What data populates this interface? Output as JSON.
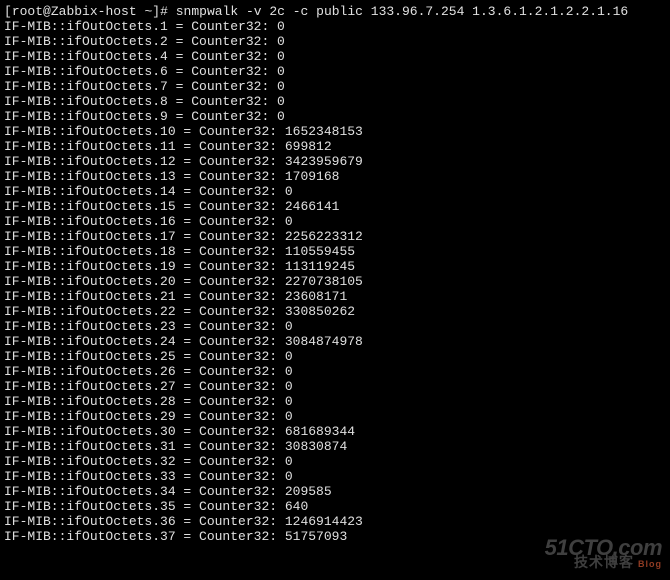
{
  "prompt": {
    "user": "root",
    "host": "Zabbix-host",
    "path": "~",
    "symbol": "#",
    "command": "snmpwalk -v 2c -c public 133.96.7.254 1.3.6.1.2.1.2.2.1.16"
  },
  "mib_prefix": "IF-MIB",
  "oid_name": "ifOutOctets",
  "counter_type": "Counter32",
  "entries": [
    {
      "index": 1,
      "value": "0"
    },
    {
      "index": 2,
      "value": "0"
    },
    {
      "index": 4,
      "value": "0"
    },
    {
      "index": 6,
      "value": "0"
    },
    {
      "index": 7,
      "value": "0"
    },
    {
      "index": 8,
      "value": "0"
    },
    {
      "index": 9,
      "value": "0"
    },
    {
      "index": 10,
      "value": "1652348153"
    },
    {
      "index": 11,
      "value": "699812"
    },
    {
      "index": 12,
      "value": "3423959679"
    },
    {
      "index": 13,
      "value": "1709168"
    },
    {
      "index": 14,
      "value": "0"
    },
    {
      "index": 15,
      "value": "2466141"
    },
    {
      "index": 16,
      "value": "0"
    },
    {
      "index": 17,
      "value": "2256223312"
    },
    {
      "index": 18,
      "value": "110559455"
    },
    {
      "index": 19,
      "value": "113119245"
    },
    {
      "index": 20,
      "value": "2270738105"
    },
    {
      "index": 21,
      "value": "23608171"
    },
    {
      "index": 22,
      "value": "330850262"
    },
    {
      "index": 23,
      "value": "0"
    },
    {
      "index": 24,
      "value": "3084874978"
    },
    {
      "index": 25,
      "value": "0"
    },
    {
      "index": 26,
      "value": "0"
    },
    {
      "index": 27,
      "value": "0"
    },
    {
      "index": 28,
      "value": "0"
    },
    {
      "index": 29,
      "value": "0"
    },
    {
      "index": 30,
      "value": "681689344"
    },
    {
      "index": 31,
      "value": "30830874"
    },
    {
      "index": 32,
      "value": "0"
    },
    {
      "index": 33,
      "value": "0"
    },
    {
      "index": 34,
      "value": "209585"
    },
    {
      "index": 35,
      "value": "640"
    },
    {
      "index": 36,
      "value": "1246914423"
    },
    {
      "index": 37,
      "value": "51757093"
    }
  ],
  "watermark": {
    "top": "51CTO.com",
    "bottom": "技术博客",
    "blog": "Blog"
  }
}
